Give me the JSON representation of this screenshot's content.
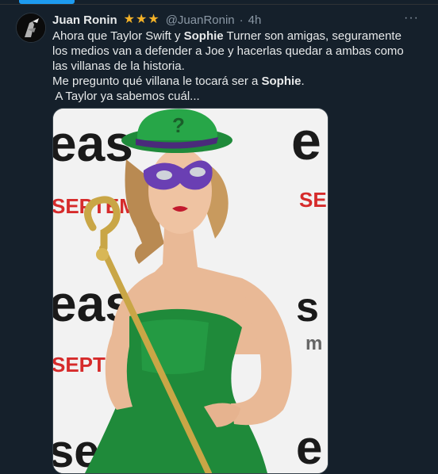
{
  "tweet": {
    "author_name": "Juan Ronin",
    "handle": "@JuanRonin",
    "separator": "·",
    "time": "4h",
    "more_label": "···",
    "lines": {
      "l1_a": "Ahora que Taylor Swift y ",
      "l1_b": "Sophie",
      "l1_c": " Turner son amigas, seguramente los medios van a defender a Joe y hacerlas quedar a ambas como las villanas de la historia.",
      "l2_a": "Me pregunto qué villana le tocará ser a ",
      "l2_b": "Sophie",
      "l2_c": ".",
      "l3": " A Taylor ya sabemos cuál..."
    }
  },
  "media": {
    "backdrop_words": [
      "eas",
      "SEPTEMBE",
      "eas",
      "SEPTEM",
      "se"
    ],
    "right_words": [
      "e",
      "SE",
      "s",
      "m"
    ]
  },
  "colors": {
    "background": "#15202b",
    "text": "#e7e9ea",
    "muted": "#8b98a5",
    "accent": "#1d9bf0",
    "star": "#f4b228",
    "hat_green": "#27a648",
    "dress_green": "#1f8a3a",
    "mask_purple": "#6a3fb3",
    "cane_gold": "#c9a646",
    "backdrop_red": "#d62b2b"
  },
  "icons": [
    "star-icon",
    "more-icon",
    "avatar-image"
  ]
}
